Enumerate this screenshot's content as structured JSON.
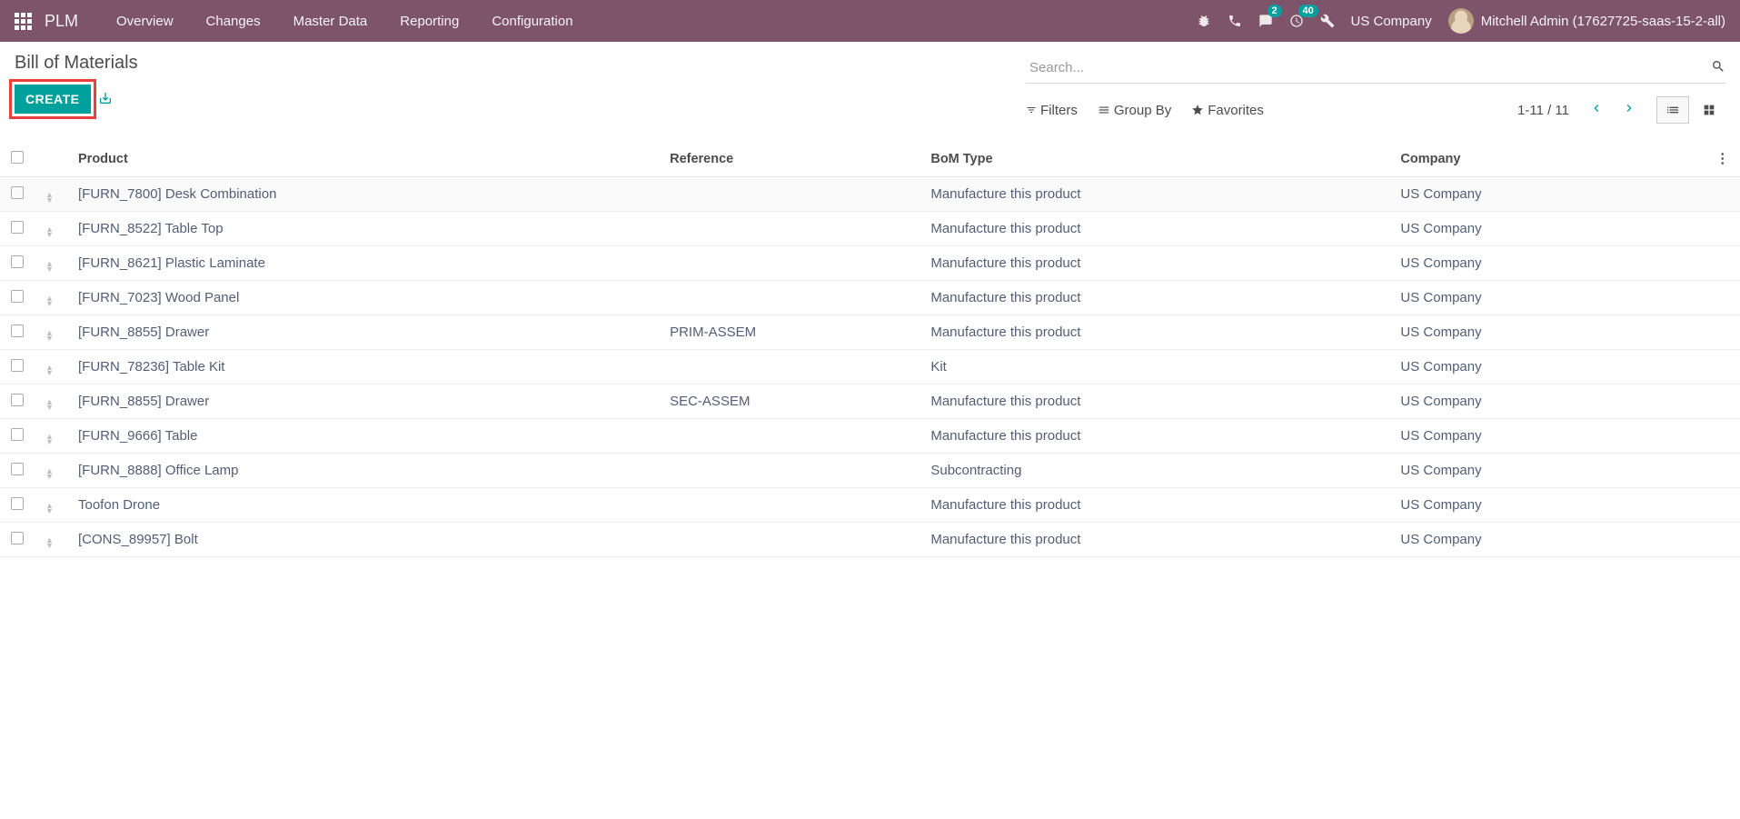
{
  "navbar": {
    "app_title": "PLM",
    "menu": [
      "Overview",
      "Changes",
      "Master Data",
      "Reporting",
      "Configuration"
    ],
    "chat_badge": "2",
    "activity_badge": "40",
    "company": "US Company",
    "user": "Mitchell Admin (17627725-saas-15-2-all)"
  },
  "page": {
    "breadcrumb": "Bill of Materials",
    "create_label": "CREATE"
  },
  "search": {
    "placeholder": "Search...",
    "filters_label": "Filters",
    "groupby_label": "Group By",
    "favorites_label": "Favorites",
    "pager": "1-11 / 11"
  },
  "table": {
    "headers": {
      "product": "Product",
      "reference": "Reference",
      "bom_type": "BoM Type",
      "company": "Company"
    },
    "rows": [
      {
        "product": "[FURN_7800] Desk Combination",
        "reference": "",
        "bom_type": "Manufacture this product",
        "company": "US Company",
        "highlight": true
      },
      {
        "product": "[FURN_8522] Table Top",
        "reference": "",
        "bom_type": "Manufacture this product",
        "company": "US Company"
      },
      {
        "product": "[FURN_8621] Plastic Laminate",
        "reference": "",
        "bom_type": "Manufacture this product",
        "company": "US Company"
      },
      {
        "product": "[FURN_7023] Wood Panel",
        "reference": "",
        "bom_type": "Manufacture this product",
        "company": "US Company"
      },
      {
        "product": "[FURN_8855] Drawer",
        "reference": "PRIM-ASSEM",
        "bom_type": "Manufacture this product",
        "company": "US Company"
      },
      {
        "product": "[FURN_78236] Table Kit",
        "reference": "",
        "bom_type": "Kit",
        "company": "US Company"
      },
      {
        "product": "[FURN_8855] Drawer",
        "reference": "SEC-ASSEM",
        "bom_type": "Manufacture this product",
        "company": "US Company"
      },
      {
        "product": "[FURN_9666] Table",
        "reference": "",
        "bom_type": "Manufacture this product",
        "company": "US Company"
      },
      {
        "product": "[FURN_8888] Office Lamp",
        "reference": "",
        "bom_type": "Subcontracting",
        "company": "US Company"
      },
      {
        "product": "Toofon Drone",
        "reference": "",
        "bom_type": "Manufacture this product",
        "company": "US Company"
      },
      {
        "product": "[CONS_89957] Bolt",
        "reference": "",
        "bom_type": "Manufacture this product",
        "company": "US Company"
      }
    ]
  }
}
